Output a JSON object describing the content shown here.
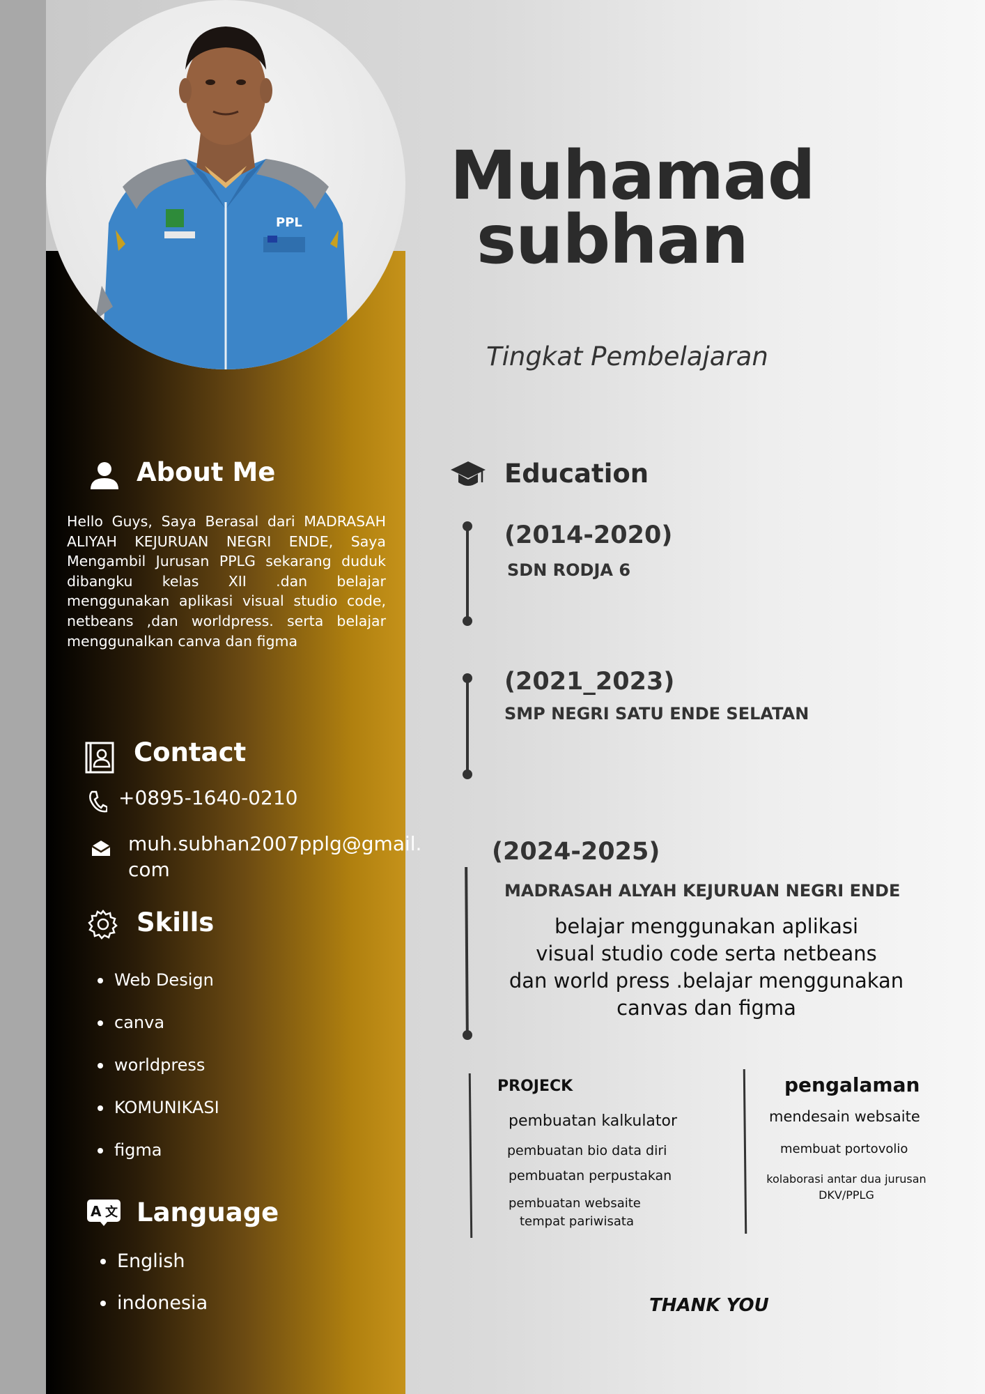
{
  "name": {
    "line1": "Muhamad",
    "line2": "subhan"
  },
  "subtitle": "Tingkat Pembelajaran",
  "about": {
    "heading": "About Me",
    "text": "Hello Guys, Saya  Berasal dari MADRASAH ALIYAH KEJURUAN NEGRI ENDE, Saya Mengambil Jurusan PPLG sekarang duduk dibangku kelas XII .dan belajar menggunakan aplikasi visual studio code, netbeans ,dan worldpress. serta belajar menggunalkan canva dan figma"
  },
  "contact": {
    "heading": "Contact",
    "phone": "+0895-1640-0210",
    "email_line1": "muh.subhan2007pplg@gmail.",
    "email_line2": "com"
  },
  "skills": {
    "heading": "Skills",
    "items": [
      "Web Design",
      "canva",
      "worldpress",
      "KOMUNIKASI",
      "figma"
    ]
  },
  "language": {
    "heading": "Language",
    "items": [
      "English",
      "indonesia"
    ]
  },
  "education": {
    "heading": "Education",
    "entries": [
      {
        "years": "(2014-2020)",
        "school": "SDN RODJA 6"
      },
      {
        "years": "(2021_2023)",
        "school": "SMP NEGRI SATU ENDE SELATAN"
      },
      {
        "years": "(2024-2025)",
        "school": "MADRASAH ALYAH KEJURUAN NEGRI ENDE",
        "desc": [
          "belajar  menggunakan aplikasi",
          "visual studio code serta netbeans",
          "dan world press .belajar menggunakan",
          "canvas dan figma"
        ]
      }
    ]
  },
  "projects": {
    "heading": "PROJECK",
    "items": [
      "pembuatan kalkulator",
      "pembuatan bio data diri",
      "pembuatan perpustakan",
      "pembuatan websaite",
      "tempat pariwisata"
    ]
  },
  "experience": {
    "heading": "pengalaman",
    "items": [
      "mendesain  websaite",
      "membuat portovolio",
      "kolaborasi antar dua jurusan",
      "DKV/PPLG"
    ]
  },
  "closing": "THANK YOU",
  "colors": {
    "gold": "#c5921a",
    "dark": "#2b2b2b"
  }
}
